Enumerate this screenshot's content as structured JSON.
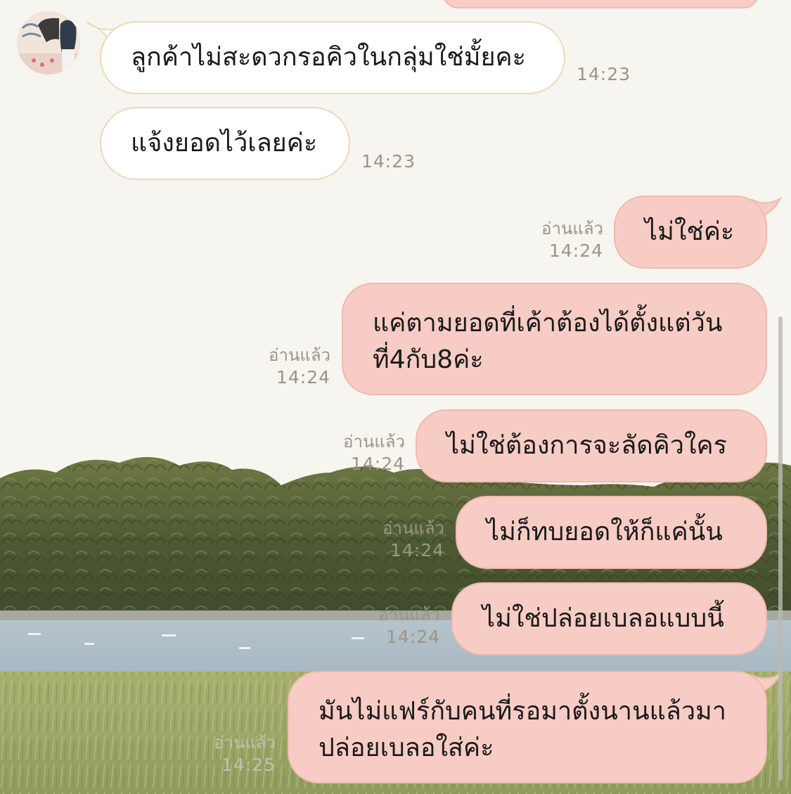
{
  "incoming_messages": [
    {
      "text": "ลูกค้าไม่สะดวกรอคิวในกลุ่มใช่มั้ยคะ",
      "time": "14:23"
    },
    {
      "text": "แจ้งยอดไว้เลยค่ะ",
      "time": "14:23"
    }
  ],
  "outgoing_messages": [
    {
      "lines": [
        "ไม่ใช่ค่ะ"
      ],
      "read": "อ่านแล้ว",
      "time": "14:24"
    },
    {
      "lines": [
        "แค่ตามยอดที่เค้าต้องได้ตั้งแต่วัน",
        "ที่4กับ8ค่ะ"
      ],
      "read": "อ่านแล้ว",
      "time": "14:24"
    },
    {
      "lines": [
        "ไม่ใช่ต้องการจะลัดคิวใคร"
      ],
      "read": "อ่านแล้ว",
      "time": "14:24"
    },
    {
      "lines": [
        "ไม่ก็ทบยอดให้ก็แค่นั้น"
      ],
      "read": "อ่านแล้ว",
      "time": "14:24"
    },
    {
      "lines": [
        "ไม่ใช่ปล่อยเบลอแบบนี้"
      ],
      "read": "อ่านแล้ว",
      "time": "14:24"
    },
    {
      "lines": [
        "มันไม่แฟร์กับคนที่รอมาตั้งนานแล้วมา",
        "ปล่อยเบลอใส่ค่ะ"
      ],
      "read": "อ่านแล้ว",
      "time": "14:25"
    }
  ],
  "avatar_icon": "user-avatar-icon",
  "colors": {
    "incoming_bubble": "#ffffff",
    "incoming_border": "#eadbb5",
    "outgoing_bubble": "#f7ccc4",
    "outgoing_border": "#f1b9ae",
    "chat_background": "#f7f5ef",
    "meta_text": "#9b9588"
  }
}
